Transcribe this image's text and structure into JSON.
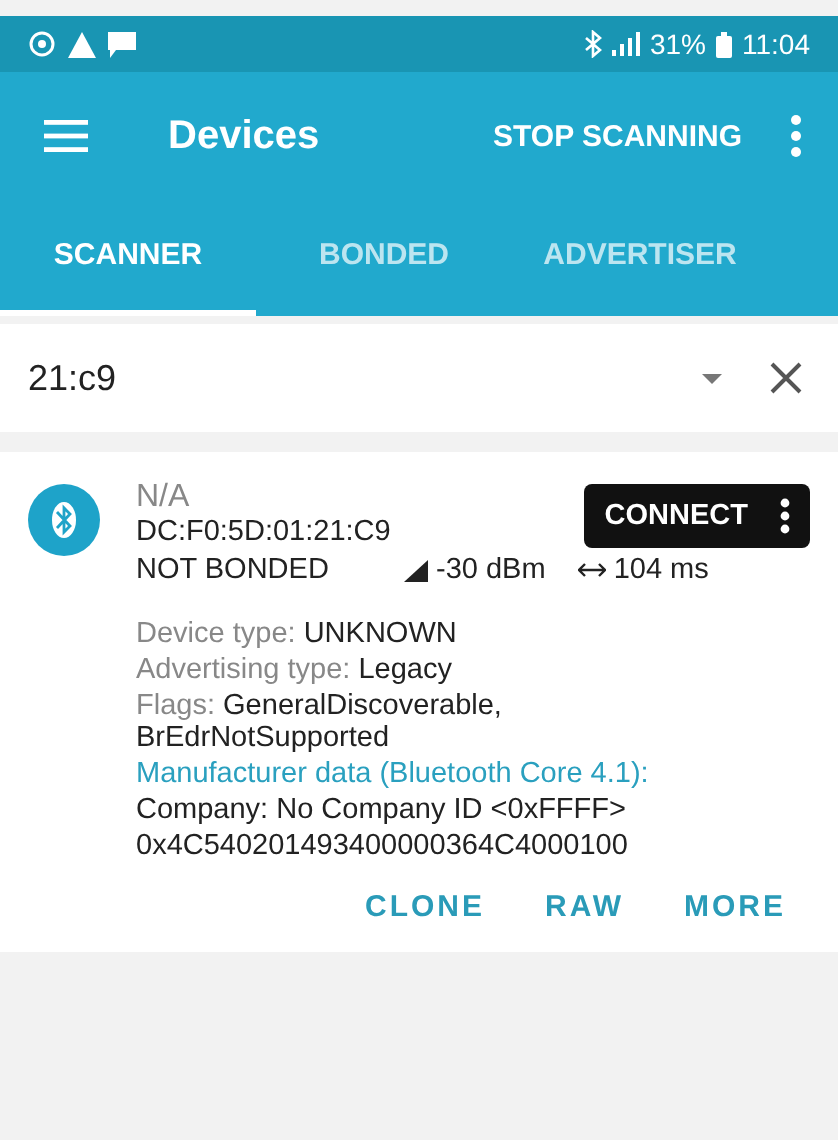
{
  "status_bar": {
    "battery": "31%",
    "time": "11:04"
  },
  "app_bar": {
    "title": "Devices",
    "action": "STOP SCANNING"
  },
  "tabs": [
    {
      "label": "SCANNER",
      "selected": true
    },
    {
      "label": "BONDED",
      "selected": false
    },
    {
      "label": "ADVERTISER",
      "selected": false
    }
  ],
  "filter": {
    "value": "21:c9"
  },
  "device": {
    "name": "N/A",
    "address": "DC:F0:5D:01:21:C9",
    "bond_state": "NOT BONDED",
    "rssi": "-30 dBm",
    "interval": "104 ms",
    "connect": "CONNECT",
    "details": [
      {
        "label": "Device type:",
        "value": "UNKNOWN"
      },
      {
        "label": "Advertising type:",
        "value": "Legacy"
      },
      {
        "label": "Flags:",
        "value": "GeneralDiscoverable, BrEdrNotSupported"
      }
    ],
    "manufacturer": {
      "heading": "Manufacturer data (Bluetooth Core 4.1):",
      "lines": [
        "Company: No Company ID <0xFFFF>",
        "0x4C540201493400000364C4000100"
      ]
    },
    "actions": [
      "CLONE",
      "RAW",
      "MORE"
    ]
  }
}
